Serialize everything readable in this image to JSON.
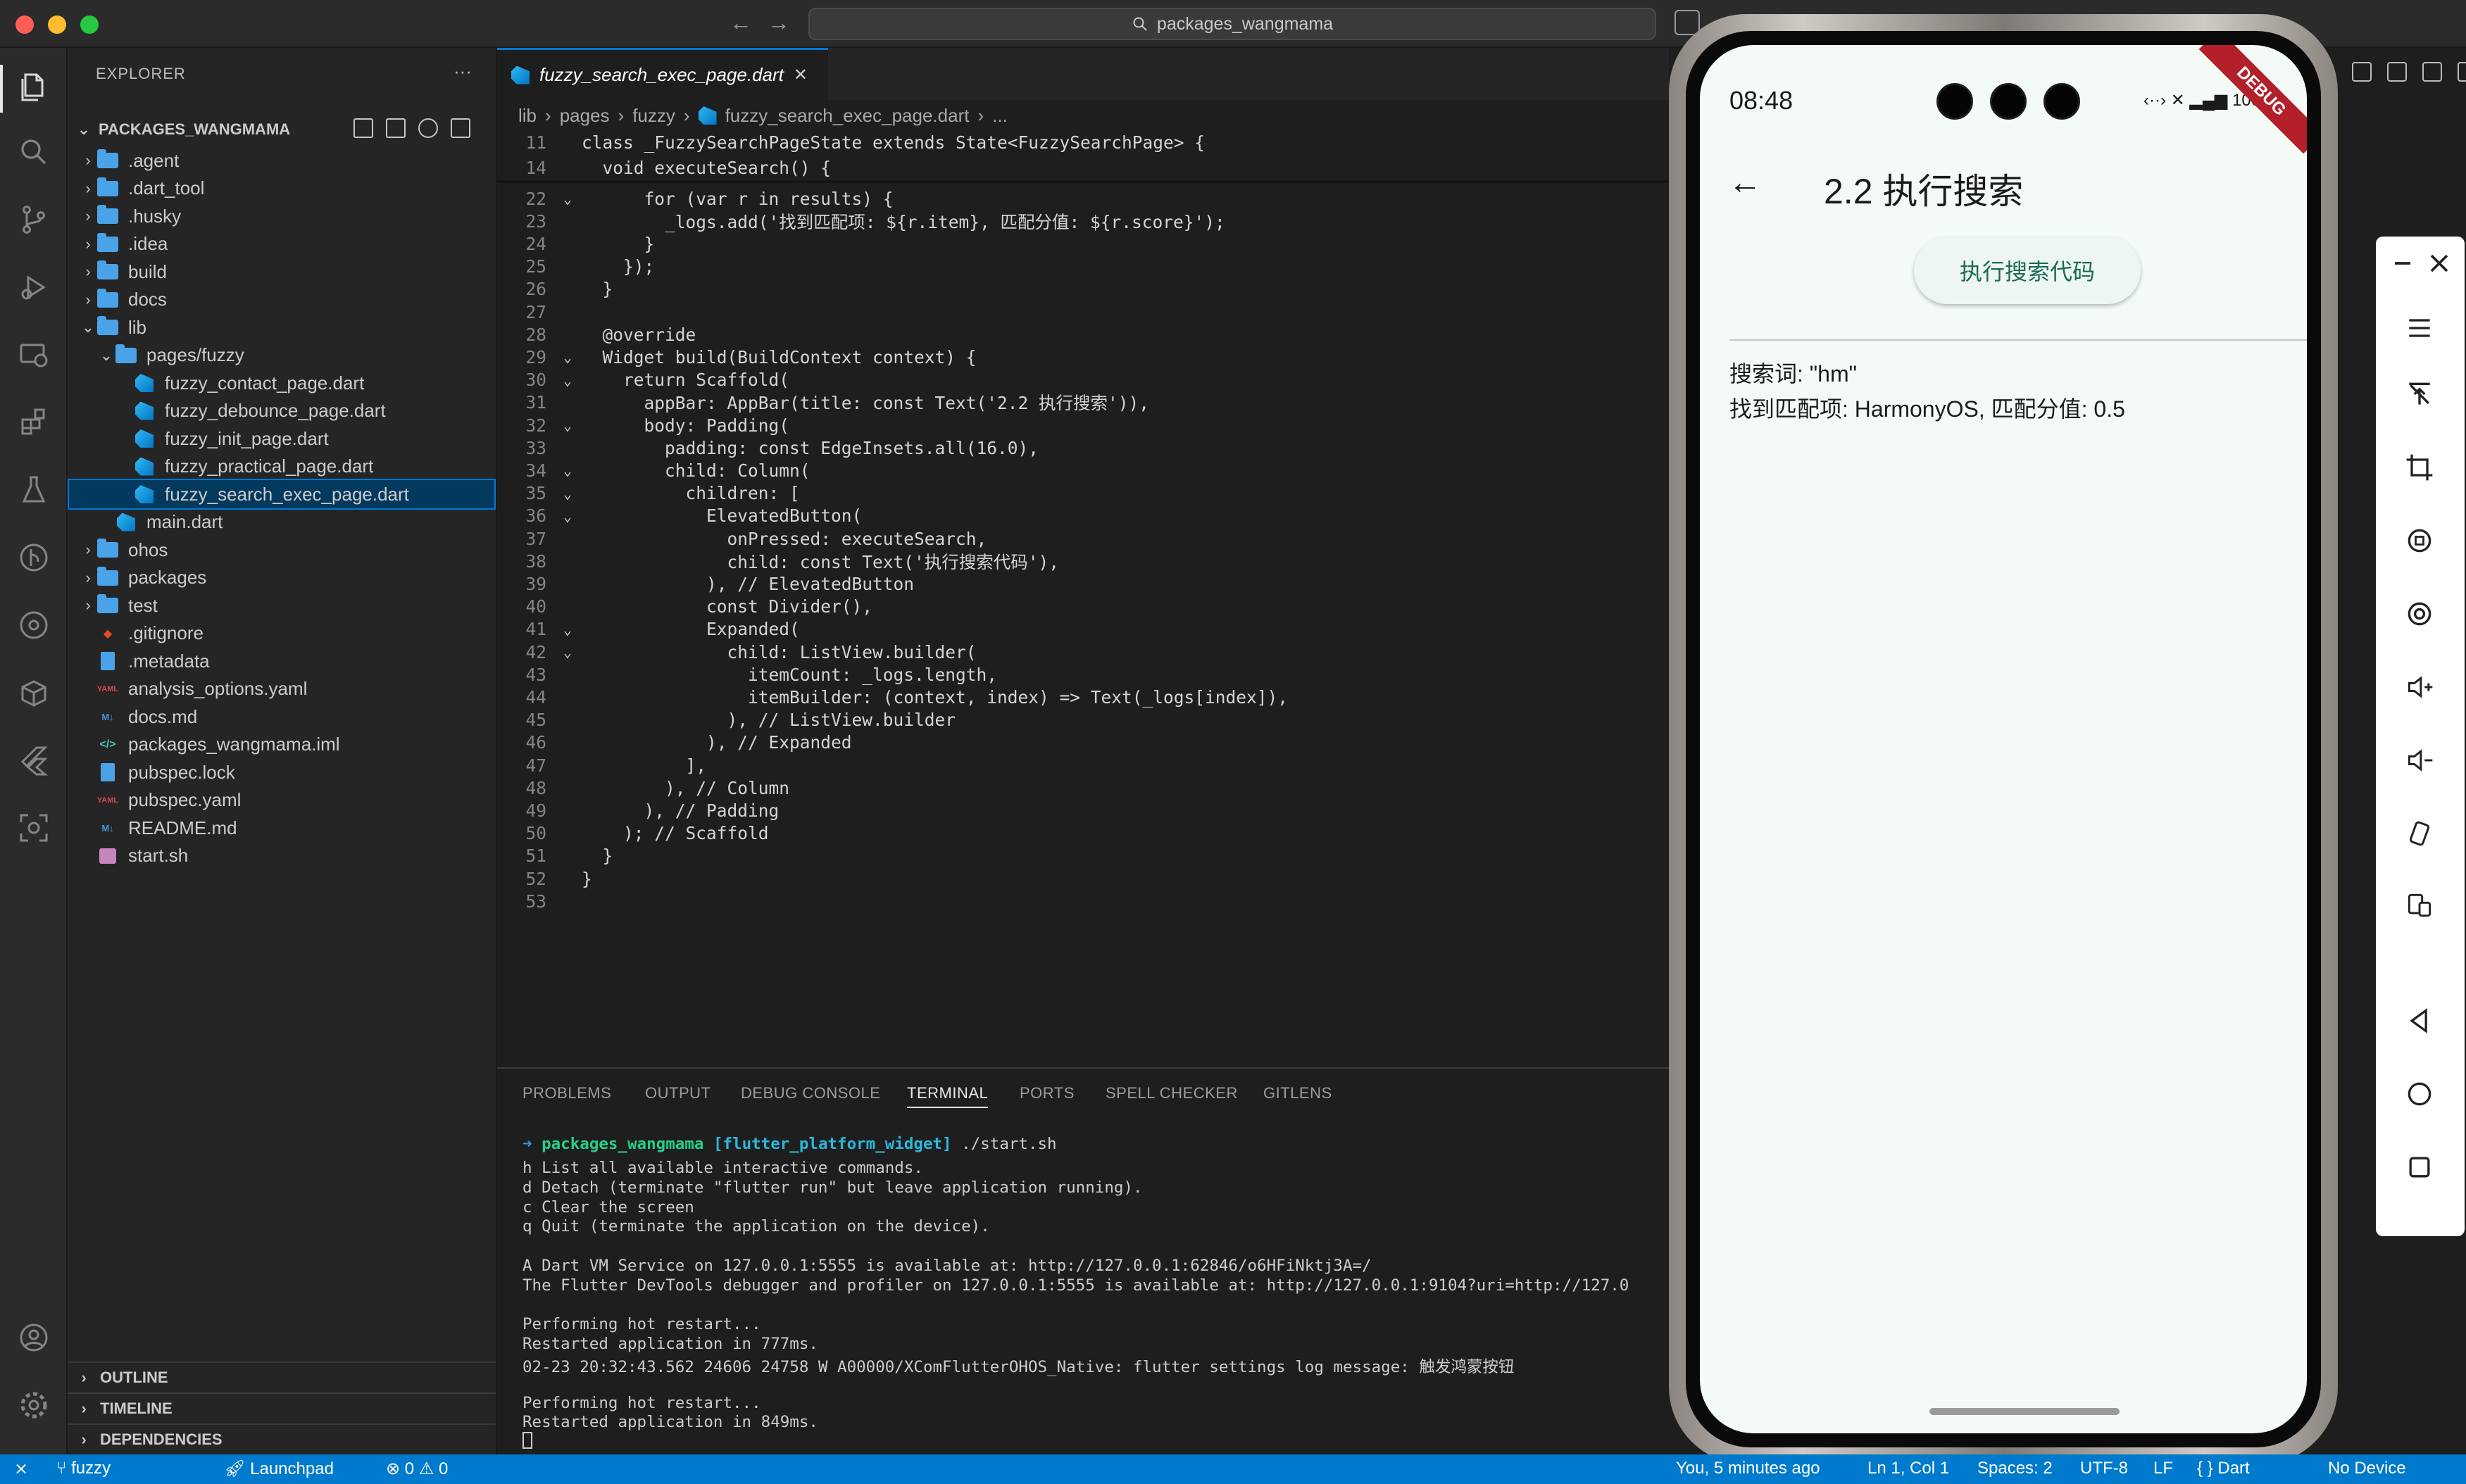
{
  "window": {
    "command_center_text": "packages_wangmama",
    "traffic_lights": {
      "close": "#ff5f57",
      "minimize": "#febc2e",
      "maximize": "#28c840"
    }
  },
  "activity_bar": {
    "icons": [
      "files-icon",
      "search-icon",
      "source-control-icon",
      "run-debug-icon",
      "remote-explorer-icon",
      "extensions-icon",
      "testing-icon",
      "gitlens-icon",
      "git-graph-icon",
      "containers-icon",
      "flutter-icon",
      "screenshot-icon"
    ],
    "bottom_icons": [
      "account-icon",
      "settings-gear-icon"
    ]
  },
  "sidebar": {
    "title": "EXPLORER",
    "title_actions": "···",
    "root": "PACKAGES_WANGMAMA",
    "items": [
      {
        "label": ".agent",
        "type": "folder",
        "depth": 1,
        "expanded": false
      },
      {
        "label": ".dart_tool",
        "type": "folder",
        "depth": 1,
        "expanded": false
      },
      {
        "label": ".husky",
        "type": "folder",
        "depth": 1,
        "expanded": false
      },
      {
        "label": ".idea",
        "type": "folder",
        "depth": 1,
        "expanded": false
      },
      {
        "label": "build",
        "type": "folder",
        "depth": 1,
        "expanded": false
      },
      {
        "label": "docs",
        "type": "folder",
        "depth": 1,
        "expanded": false
      },
      {
        "label": "lib",
        "type": "folder",
        "depth": 1,
        "expanded": true
      },
      {
        "label": "pages/fuzzy",
        "type": "folder",
        "depth": 2,
        "expanded": true
      },
      {
        "label": "fuzzy_contact_page.dart",
        "type": "dart",
        "depth": 3
      },
      {
        "label": "fuzzy_debounce_page.dart",
        "type": "dart",
        "depth": 3
      },
      {
        "label": "fuzzy_init_page.dart",
        "type": "dart",
        "depth": 3
      },
      {
        "label": "fuzzy_practical_page.dart",
        "type": "dart",
        "depth": 3
      },
      {
        "label": "fuzzy_search_exec_page.dart",
        "type": "dart",
        "depth": 3,
        "selected": true
      },
      {
        "label": "main.dart",
        "type": "dart",
        "depth": 2
      },
      {
        "label": "ohos",
        "type": "folder",
        "depth": 1,
        "expanded": false
      },
      {
        "label": "packages",
        "type": "folder",
        "depth": 1,
        "expanded": false
      },
      {
        "label": "test",
        "type": "folder",
        "depth": 1,
        "expanded": false
      },
      {
        "label": ".gitignore",
        "type": "git",
        "depth": 1
      },
      {
        "label": ".metadata",
        "type": "file",
        "depth": 1
      },
      {
        "label": "analysis_options.yaml",
        "type": "yaml",
        "depth": 1
      },
      {
        "label": "docs.md",
        "type": "md",
        "depth": 1
      },
      {
        "label": "packages_wangmama.iml",
        "type": "xml",
        "depth": 1
      },
      {
        "label": "pubspec.lock",
        "type": "file",
        "depth": 1
      },
      {
        "label": "pubspec.yaml",
        "type": "yaml",
        "depth": 1
      },
      {
        "label": "README.md",
        "type": "md",
        "depth": 1
      },
      {
        "label": "start.sh",
        "type": "shell",
        "depth": 1
      }
    ],
    "sections": [
      "OUTLINE",
      "TIMELINE",
      "DEPENDENCIES"
    ]
  },
  "editor": {
    "tab": {
      "label": "fuzzy_search_exec_page.dart",
      "close": "✕"
    },
    "breadcrumb": [
      "lib",
      "pages",
      "fuzzy",
      "fuzzy_search_exec_page.dart",
      "..."
    ],
    "lines": [
      {
        "n": "11",
        "fold": "",
        "code": "class _FuzzySearchPageState extends State<FuzzySearchPage> {",
        "sticky": true
      },
      {
        "n": "14",
        "fold": "",
        "code": "  void executeSearch() {",
        "sticky": true
      },
      {
        "n": "22",
        "fold": "⌄",
        "code": "      for (var r in results) {"
      },
      {
        "n": "23",
        "fold": "",
        "code": "        _logs.add('找到匹配项: ${r.item}, 匹配分值: ${r.score}');"
      },
      {
        "n": "24",
        "fold": "",
        "code": "      }"
      },
      {
        "n": "25",
        "fold": "",
        "code": "    });"
      },
      {
        "n": "26",
        "fold": "",
        "code": "  }"
      },
      {
        "n": "27",
        "fold": "",
        "code": ""
      },
      {
        "n": "28",
        "fold": "",
        "code": "  @override"
      },
      {
        "n": "29",
        "fold": "⌄",
        "code": "  Widget build(BuildContext context) {"
      },
      {
        "n": "30",
        "fold": "⌄",
        "code": "    return Scaffold("
      },
      {
        "n": "31",
        "fold": "",
        "code": "      appBar: AppBar(title: const Text('2.2 执行搜索')),"
      },
      {
        "n": "32",
        "fold": "⌄",
        "code": "      body: Padding("
      },
      {
        "n": "33",
        "fold": "",
        "code": "        padding: const EdgeInsets.all(16.0),"
      },
      {
        "n": "34",
        "fold": "⌄",
        "code": "        child: Column("
      },
      {
        "n": "35",
        "fold": "⌄",
        "code": "          children: ["
      },
      {
        "n": "36",
        "fold": "⌄",
        "code": "            ElevatedButton("
      },
      {
        "n": "37",
        "fold": "",
        "code": "              onPressed: executeSearch,"
      },
      {
        "n": "38",
        "fold": "",
        "code": "              child: const Text('执行搜索代码'),"
      },
      {
        "n": "39",
        "fold": "",
        "code": "            ), // ElevatedButton"
      },
      {
        "n": "40",
        "fold": "",
        "code": "            const Divider(),"
      },
      {
        "n": "41",
        "fold": "⌄",
        "code": "            Expanded("
      },
      {
        "n": "42",
        "fold": "⌄",
        "code": "              child: ListView.builder("
      },
      {
        "n": "43",
        "fold": "",
        "code": "                itemCount: _logs.length,"
      },
      {
        "n": "44",
        "fold": "",
        "code": "                itemBuilder: (context, index) => Text(_logs[index]),"
      },
      {
        "n": "45",
        "fold": "",
        "code": "              ), // ListView.builder"
      },
      {
        "n": "46",
        "fold": "",
        "code": "            ), // Expanded"
      },
      {
        "n": "47",
        "fold": "",
        "code": "          ],"
      },
      {
        "n": "48",
        "fold": "",
        "code": "        ), // Column"
      },
      {
        "n": "49",
        "fold": "",
        "code": "      ), // Padding"
      },
      {
        "n": "50",
        "fold": "",
        "code": "    ); // Scaffold"
      },
      {
        "n": "51",
        "fold": "",
        "code": "  }"
      },
      {
        "n": "52",
        "fold": "",
        "code": "}"
      },
      {
        "n": "53",
        "fold": "",
        "code": ""
      }
    ]
  },
  "panel": {
    "tabs": [
      "PROBLEMS",
      "OUTPUT",
      "DEBUG CONSOLE",
      "TERMINAL",
      "PORTS",
      "SPELL CHECKER",
      "GITLENS"
    ],
    "active_tab": "TERMINAL",
    "prompt_dir": "packages_wangmama",
    "prompt_branch": "[flutter_platform_widget]",
    "prompt_cmd": "./start.sh",
    "lines": [
      "h List all available interactive commands.",
      "d Detach (terminate \"flutter run\" but leave application running).",
      "c Clear the screen",
      "q Quit (terminate the application on the device).",
      "",
      "A Dart VM Service on 127.0.0.1:5555 is available at: http://127.0.0.1:62846/o6HFiNktj3A=/",
      "The Flutter DevTools debugger and profiler on 127.0.0.1:5555 is available at: http://127.0.0.1:9104?uri=http://127.0",
      "",
      "Performing hot restart...",
      "Restarted application in 777ms.",
      "02-23 20:32:43.562 24606 24758 W A00000/XComFlutterOHOS_Native: flutter settings log message: 触发鸿蒙按钮",
      "",
      "Performing hot restart...",
      "Restarted application in 849ms."
    ]
  },
  "phone": {
    "time": "08:48",
    "status_icons": "‹··› ✕ ▂▄▆ 100",
    "debug_banner": "DEBUG",
    "app_title": "2.2 执行搜索",
    "button_label": "执行搜索代码",
    "logs": [
      "搜索词: \"hm\"",
      "找到匹配项: HarmonyOS, 匹配分值: 0.5"
    ]
  },
  "emulator_toolbar": {
    "icons": [
      "minimize-icon",
      "close-icon",
      "menu-icon",
      "no-touch-icon",
      "crop-icon",
      "rotate-icon",
      "screenshot-record-icon",
      "volume-up-icon",
      "volume-down-icon",
      "shake-icon",
      "fold-icon",
      "back-icon",
      "home-icon",
      "recents-icon"
    ]
  },
  "status_bar": {
    "remote": "⨯",
    "branch": "fuzzy",
    "launchpad": "Launchpad",
    "errors": "0",
    "warnings": "0",
    "blame": "You, 5 minutes ago",
    "cursor": "Ln 1, Col 1",
    "spaces": "Spaces: 2",
    "encoding": "UTF-8",
    "eol": "LF",
    "language": "Dart",
    "device": "No Device"
  }
}
